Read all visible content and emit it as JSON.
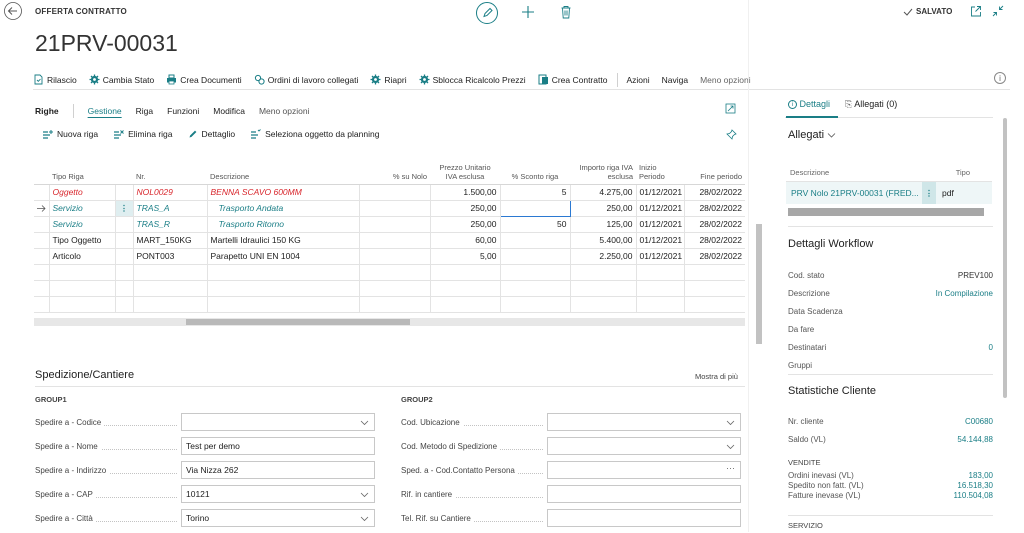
{
  "header": {
    "page_type": "OFFERTA CONTRATTO",
    "title": "21PRV-00031",
    "saved_label": "SALVATO"
  },
  "actions": {
    "items": [
      {
        "label": "Rilascio",
        "icon": "release-icon"
      },
      {
        "label": "Cambia Stato",
        "icon": "gear-icon"
      },
      {
        "label": "Crea Documenti",
        "icon": "printer-icon"
      },
      {
        "label": "Ordini di lavoro collegati",
        "icon": "work-order-icon"
      },
      {
        "label": "Riapri",
        "icon": "gear-icon"
      },
      {
        "label": "Sblocca Ricalcolo Prezzi",
        "icon": "gear-icon"
      },
      {
        "label": "Crea Contratto",
        "icon": "contract-icon"
      }
    ],
    "azioni": "Azioni",
    "naviga": "Naviga",
    "meno_opzioni": "Meno opzioni"
  },
  "lines": {
    "tab_righe": "Righe",
    "tabs": [
      "Gestione",
      "Riga",
      "Funzioni",
      "Modifica",
      "Meno opzioni"
    ],
    "line_actions": [
      {
        "label": "Nuova riga",
        "icon": "new-line-icon"
      },
      {
        "label": "Elimina riga",
        "icon": "delete-line-icon"
      },
      {
        "label": "Dettaglio",
        "icon": "pencil-icon"
      },
      {
        "label": "Seleziona oggetto da planning",
        "icon": "planning-icon"
      }
    ],
    "columns": {
      "tipo": "Tipo Riga",
      "nr": "Nr.",
      "descrizione": "Descrizione",
      "nolo": "% su Nolo",
      "prezzo": "Prezzo Unitario IVA esclusa",
      "sconto": "% Sconto riga",
      "importo": "Importo riga IVA esclusa",
      "inizio": "Inizio Periodo",
      "fine": "Fine periodo"
    },
    "rows": [
      {
        "tipo": "Oggetto",
        "nr": "NOL0029",
        "descrizione": "BENNA SCAVO 600MM",
        "nolo": "",
        "prezzo": "1.500,00",
        "sconto": "5",
        "importo": "4.275,00",
        "inizio": "01/12/2021",
        "fine": "28/02/2022"
      },
      {
        "tipo": "Servizio",
        "nr": "TRAS_A",
        "descrizione": "Trasporto Andata",
        "nolo": "",
        "prezzo": "250,00",
        "sconto": "",
        "importo": "250,00",
        "inizio": "01/12/2021",
        "fine": "28/02/2022"
      },
      {
        "tipo": "Servizio",
        "nr": "TRAS_R",
        "descrizione": "Trasporto Ritorno",
        "nolo": "",
        "prezzo": "250,00",
        "sconto": "50",
        "importo": "125,00",
        "inizio": "01/12/2021",
        "fine": "28/02/2022"
      },
      {
        "tipo": "Tipo Oggetto",
        "nr": "MART_150KG",
        "descrizione": "Martelli Idraulici 150 KG",
        "nolo": "",
        "prezzo": "60,00",
        "sconto": "",
        "importo": "5.400,00",
        "inizio": "01/12/2021",
        "fine": "28/02/2022"
      },
      {
        "tipo": "Articolo",
        "nr": "PONT003",
        "descrizione": "Parapetto UNI EN 1004",
        "nolo": "",
        "prezzo": "5,00",
        "sconto": "",
        "importo": "2.250,00",
        "inizio": "01/12/2021",
        "fine": "28/02/2022"
      }
    ]
  },
  "shipping": {
    "title": "Spedizione/Cantiere",
    "show_more": "Mostra di più",
    "group1": "GROUP1",
    "group2": "GROUP2",
    "left_fields": [
      {
        "label": "Spedire a - Codice",
        "value": ""
      },
      {
        "label": "Spedire a - Nome",
        "value": "Test per demo"
      },
      {
        "label": "Spedire a - Indirizzo",
        "value": "Via Nizza 262"
      },
      {
        "label": "Spedire a - CAP",
        "value": "10121"
      },
      {
        "label": "Spedire a - Città",
        "value": "Torino"
      }
    ],
    "right_fields": [
      {
        "label": "Cod. Ubicazione",
        "value": ""
      },
      {
        "label": "Cod. Metodo di Spedizione",
        "value": ""
      },
      {
        "label": "Sped. a - Cod.Contatto Persona",
        "value": ""
      },
      {
        "label": "Rif. in cantiere",
        "value": ""
      },
      {
        "label": "Tel. Rif. su Cantiere",
        "value": ""
      }
    ]
  },
  "factbox": {
    "tab_details": "Dettagli",
    "tab_attachments": "Allegati (0)",
    "allegati_title": "Allegati",
    "allegati_col_desc": "Descrizione",
    "allegati_col_type": "Tipo",
    "allegato_name": "PRV Nolo 21PRV-00031 (FRED...",
    "allegato_type": "pdf",
    "workflow_title": "Dettagli Workflow",
    "workflow": [
      {
        "label": "Cod. stato",
        "value": "PREV100"
      },
      {
        "label": "Descrizione",
        "value": "In Compilazione"
      },
      {
        "label": "Data Scadenza",
        "value": ""
      },
      {
        "label": "Da fare",
        "value": ""
      },
      {
        "label": "Destinatari",
        "value": "0"
      },
      {
        "label": "Gruppi",
        "value": ""
      }
    ],
    "stats_title": "Statistiche Cliente",
    "nr_cliente_label": "Nr. cliente",
    "nr_cliente": "C00680",
    "saldo_label": "Saldo (VL)",
    "saldo": "54.144,88",
    "vendite_title": "VENDITE",
    "vendite": [
      {
        "label": "Ordini inevasi (VL)",
        "value": "183,00"
      },
      {
        "label": "Spedito non fatt. (VL)",
        "value": "16.518,30"
      },
      {
        "label": "Fatture inevase (VL)",
        "value": "110.504,08"
      }
    ],
    "servizio_title": "SERVIZIO"
  }
}
